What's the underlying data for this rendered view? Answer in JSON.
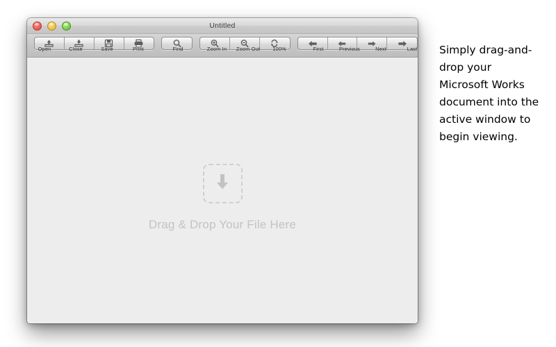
{
  "window": {
    "title": "Untitled",
    "controls": [
      {
        "name": "close-button",
        "color": "#e0453c"
      },
      {
        "name": "minimize-button",
        "color": "#e8b02c"
      },
      {
        "name": "zoom-button",
        "color": "#56bb2f"
      }
    ]
  },
  "toolbar": {
    "groups": [
      {
        "name": "file-group",
        "buttons": [
          {
            "label": "Open",
            "icon": "open-tray-icon"
          },
          {
            "label": "Close",
            "icon": "close-tray-icon"
          },
          {
            "label": "Save",
            "icon": "floppy-disk-icon"
          },
          {
            "label": "Print",
            "icon": "printer-icon"
          }
        ]
      },
      {
        "name": "find-group",
        "buttons": [
          {
            "label": "Find",
            "icon": "magnifier-icon"
          }
        ]
      },
      {
        "name": "zoom-group",
        "buttons": [
          {
            "label": "Zoom In",
            "icon": "magnifier-plus-icon"
          },
          {
            "label": "Zoom Out",
            "icon": "magnifier-minus-icon"
          },
          {
            "label": "100%",
            "icon": "refresh-loop-icon"
          }
        ]
      },
      {
        "name": "navigation-group",
        "buttons": [
          {
            "label": "First",
            "icon": "arrow-left-bold-icon"
          },
          {
            "label": "Previous",
            "icon": "arrow-left-icon"
          },
          {
            "label": "Next",
            "icon": "arrow-right-icon"
          },
          {
            "label": "Last",
            "icon": "arrow-right-bold-icon"
          }
        ]
      }
    ]
  },
  "content": {
    "dropzone": {
      "icon": "download-arrow-icon",
      "text": "Drag & Drop Your File Here"
    },
    "background_color": "#ededed"
  },
  "annotation": {
    "text": "Simply drag-and-drop your Microsoft Works document into the active window to begin viewing."
  }
}
